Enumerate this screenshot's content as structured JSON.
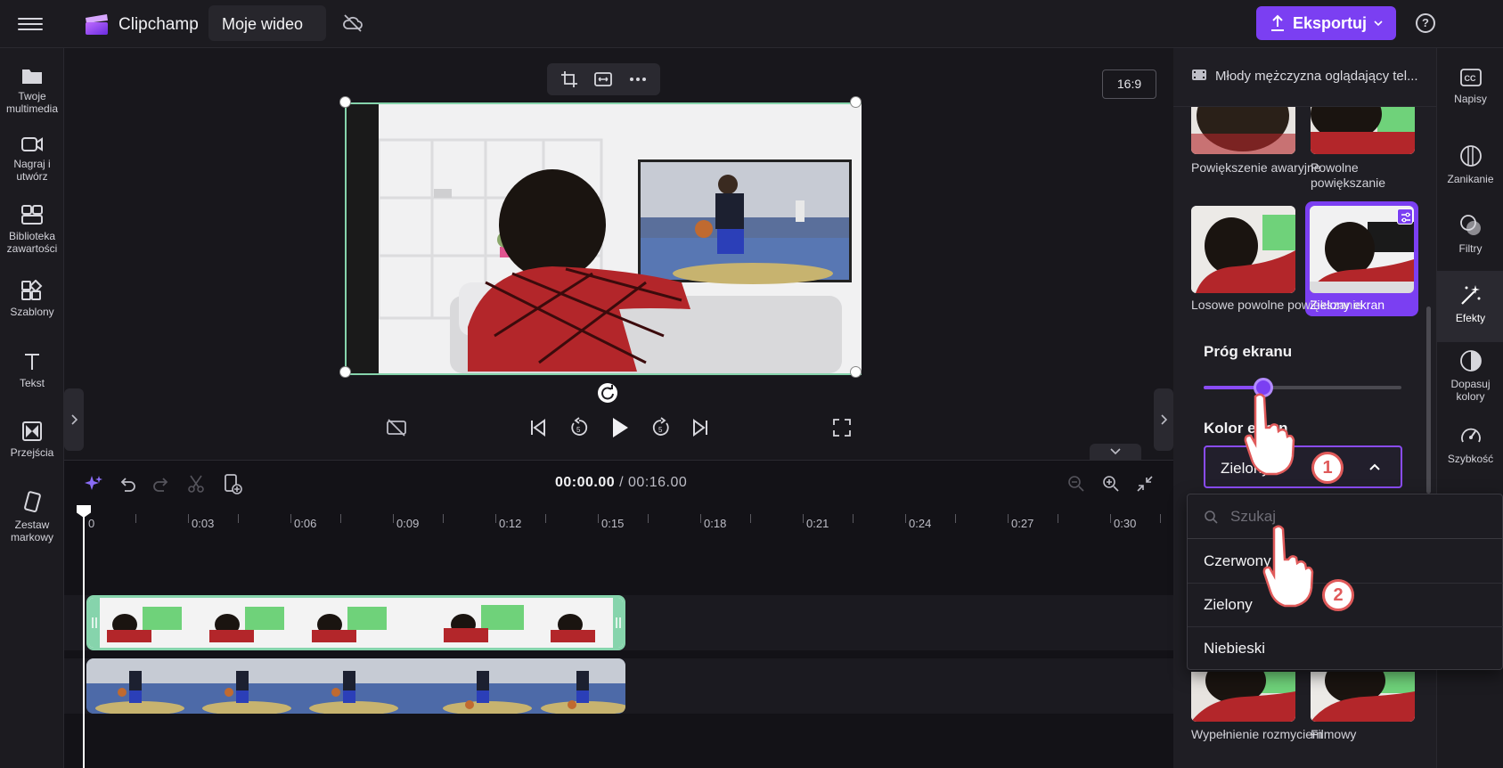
{
  "header": {
    "app_name": "Clipchamp",
    "project_name": "Moje wideo",
    "export_label": "Eksportuj",
    "help_label": "?"
  },
  "left_sidebar": {
    "items": [
      {
        "label": "Twoje multimedia"
      },
      {
        "label": "Nagraj i utwórz"
      },
      {
        "label": "Biblioteka zawartości"
      },
      {
        "label": "Szablony"
      },
      {
        "label": "Tekst"
      },
      {
        "label": "Przejścia"
      },
      {
        "label": "Zestaw markowy"
      }
    ]
  },
  "right_sidebar": {
    "items": [
      {
        "label": "Napisy",
        "icon": "captions-icon"
      },
      {
        "label": "Zanikanie",
        "icon": "fade-icon"
      },
      {
        "label": "Filtry",
        "icon": "filters-icon"
      },
      {
        "label": "Efekty",
        "icon": "effects-icon",
        "active": true
      },
      {
        "label": "Dopasuj kolory",
        "icon": "adjust-colors-icon"
      },
      {
        "label": "Szybkość",
        "icon": "speed-icon"
      }
    ]
  },
  "preview": {
    "aspect_ratio": "16:9"
  },
  "timeline": {
    "current_time": "00:00.00",
    "separator": " / ",
    "total_time": "00:16.00",
    "ruler_labels": [
      "0",
      "0:03",
      "0:06",
      "0:09",
      "0:12",
      "0:15",
      "0:18",
      "0:21",
      "0:24",
      "0:27",
      "0:30"
    ]
  },
  "effects_panel": {
    "title": "Młody mężczyzna oglądający tel...",
    "effects": [
      {
        "label": "Powiększenie awaryjne"
      },
      {
        "label": "Powolne powiększanie"
      },
      {
        "label": "Losowe powolne powiększanie"
      },
      {
        "label": "Zielony ekran",
        "selected": true
      },
      {
        "label": "Wypełnienie rozmyciem"
      },
      {
        "label": "Filmowy"
      }
    ],
    "threshold_label": "Próg ekranu",
    "threshold_value": 0.3,
    "color_label": "Kolor ekranu",
    "color_label_visible": "Kolor ekran",
    "color_selected": "Zielony"
  },
  "color_dropdown": {
    "search_placeholder": "Szukaj",
    "options": [
      "Czerwony",
      "Zielony",
      "Niebieski"
    ]
  },
  "annotations": {
    "step1": "1",
    "step2": "2"
  },
  "colors": {
    "accent": "#7b3ff2",
    "selection_border": "#86d4ac",
    "annotation": "#e05a5a"
  }
}
